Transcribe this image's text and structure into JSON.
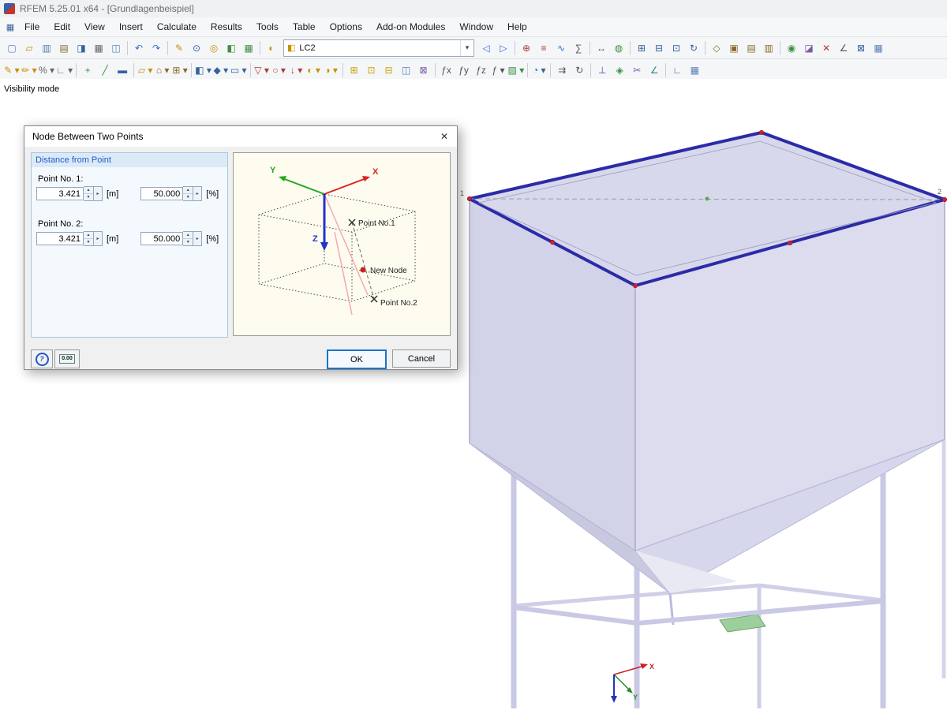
{
  "window": {
    "title": "RFEM 5.25.01 x64 - [Grundlagenbeispiel]"
  },
  "menu": {
    "items": [
      "File",
      "Edit",
      "View",
      "Insert",
      "Calculate",
      "Results",
      "Tools",
      "Table",
      "Options",
      "Add-on Modules",
      "Window",
      "Help"
    ]
  },
  "toolbar_main": {
    "left_icons": [
      {
        "name": "new-model-button",
        "glyph": "▢",
        "color": "#5a7fb5"
      },
      {
        "name": "open-model-button",
        "glyph": "▱",
        "color": "#c79100"
      },
      {
        "name": "project-manager-button",
        "glyph": "▥",
        "color": "#5a7fb5"
      },
      {
        "name": "data-navigator-button",
        "glyph": "▤",
        "color": "#8a6a2a"
      },
      {
        "name": "save-button",
        "glyph": "◨",
        "color": "#35629e"
      },
      {
        "name": "print-button",
        "glyph": "▦",
        "color": "#666666"
      },
      {
        "name": "copy-button",
        "glyph": "◫",
        "color": "#5a7fb5"
      },
      {
        "sep": true
      },
      {
        "name": "undo-button",
        "glyph": "↶",
        "color": "#2f6fd0"
      },
      {
        "name": "redo-button",
        "glyph": "↷",
        "color": "#2f6fd0"
      },
      {
        "sep": true
      },
      {
        "name": "new-load-case-button",
        "glyph": "✎",
        "color": "#c79100"
      },
      {
        "name": "zoom-select-button",
        "glyph": "⊙",
        "color": "#35629e"
      },
      {
        "name": "search-object-button",
        "glyph": "◎",
        "color": "#c79100"
      },
      {
        "name": "navigator-toggle-button",
        "glyph": "◧",
        "color": "#3f8f3f"
      },
      {
        "name": "tables-toggle-button",
        "glyph": "▦",
        "color": "#3f8f3f"
      },
      {
        "sep": true
      },
      {
        "name": "load-case-list-icon",
        "glyph": "◐",
        "color": "#c79100"
      }
    ],
    "combo": {
      "value": "LC2",
      "arrow": "▾",
      "icon": "◧"
    },
    "right_icons": [
      {
        "name": "previous-load-case-button",
        "glyph": "◁",
        "color": "#2f6fd0"
      },
      {
        "name": "next-load-case-button",
        "glyph": "▷",
        "color": "#2f6fd0"
      },
      {
        "sep": true
      },
      {
        "name": "show-loads-button",
        "glyph": "⊕",
        "color": "#b33838"
      },
      {
        "name": "show-load-values-button",
        "glyph": "≡",
        "color": "#b33838"
      },
      {
        "name": "show-results-button",
        "glyph": "∿",
        "color": "#2f6fd0"
      },
      {
        "name": "show-result-values-button",
        "glyph": "∑",
        "color": "#555555"
      },
      {
        "sep": true
      },
      {
        "name": "show-dimensions-button",
        "glyph": "↔",
        "color": "#555555"
      },
      {
        "name": "render-model-button",
        "glyph": "◍",
        "color": "#3f8f3f"
      },
      {
        "sep": true
      },
      {
        "name": "zoom-in-button",
        "glyph": "⊞",
        "color": "#35629e"
      },
      {
        "name": "zoom-out-button",
        "glyph": "⊟",
        "color": "#35629e"
      },
      {
        "name": "zoom-window-button",
        "glyph": "⊡",
        "color": "#35629e"
      },
      {
        "name": "rotate-view-button",
        "glyph": "↻",
        "color": "#35629e"
      },
      {
        "sep": true
      },
      {
        "name": "isometric-view-button",
        "glyph": "◇",
        "color": "#8a6a2a"
      },
      {
        "name": "view-in-x-button",
        "glyph": "▣",
        "color": "#8a6a2a"
      },
      {
        "name": "view-in-y-button",
        "glyph": "▤",
        "color": "#8a6a2a"
      },
      {
        "name": "view-in-z-button",
        "glyph": "▥",
        "color": "#8a6a2a"
      },
      {
        "sep": true
      },
      {
        "name": "visibility-mode-button",
        "glyph": "◉",
        "color": "#3f8f3f"
      },
      {
        "name": "clipping-plane-button",
        "glyph": "◪",
        "color": "#7a5aa0"
      },
      {
        "name": "mirror-view-button",
        "glyph": "✕",
        "color": "#b33838"
      },
      {
        "name": "measure-button",
        "glyph": "∠",
        "color": "#555555"
      },
      {
        "name": "full-view-button",
        "glyph": "⊠",
        "color": "#35629e"
      },
      {
        "name": "table-layout-button",
        "glyph": "▦",
        "color": "#5a7fb5"
      }
    ]
  },
  "toolbar_edit": {
    "icons": [
      {
        "name": "edit-dimensions-button",
        "glyph": "✎ ▾",
        "color": "#c79100"
      },
      {
        "name": "edit-comments-button",
        "glyph": "✏ ▾",
        "color": "#c79100"
      },
      {
        "name": "percent-snap-button",
        "glyph": "% ▾",
        "color": "#666666"
      },
      {
        "name": "ortho-snap-button",
        "glyph": "∟ ▾",
        "color": "#666666"
      },
      {
        "sep": true
      },
      {
        "name": "new-node-button",
        "glyph": "+",
        "color": "#3f8f3f"
      },
      {
        "name": "new-line-button",
        "glyph": "╱",
        "color": "#3f8f3f"
      },
      {
        "name": "new-member-button",
        "glyph": "▬",
        "color": "#35629e"
      },
      {
        "sep": true
      },
      {
        "name": "generated-objects-button",
        "glyph": "▱ ▾",
        "color": "#c79100"
      },
      {
        "name": "model-tools-button",
        "glyph": "⌂ ▾",
        "color": "#8a6a2a"
      },
      {
        "name": "block-library-button",
        "glyph": "⊞ ▾",
        "color": "#8a6a2a"
      },
      {
        "sep": true
      },
      {
        "name": "new-surface-button",
        "glyph": "◧ ▾",
        "color": "#35629e"
      },
      {
        "name": "new-solid-button",
        "glyph": "◆ ▾",
        "color": "#35629e"
      },
      {
        "name": "new-opening-button",
        "glyph": "▭ ▾",
        "color": "#35629e"
      },
      {
        "sep": true
      },
      {
        "name": "new-support-button",
        "glyph": "▽ ▾",
        "color": "#b33838"
      },
      {
        "name": "new-hinge-button",
        "glyph": "○ ▾",
        "color": "#b33838"
      },
      {
        "name": "new-load-button",
        "glyph": "↓ ▾",
        "color": "#b33838"
      },
      {
        "name": "load-cases-button",
        "glyph": "◐ ▾",
        "color": "#c79100"
      },
      {
        "name": "combinations-button",
        "glyph": "◑ ▾",
        "color": "#c79100"
      },
      {
        "sep": true
      },
      {
        "name": "select-window-button",
        "glyph": "⊞",
        "color": "#caa000"
      },
      {
        "name": "select-special-button",
        "glyph": "⊡",
        "color": "#caa000"
      },
      {
        "name": "deselect-button",
        "glyph": "⊟",
        "color": "#caa000"
      },
      {
        "name": "select-layer-button",
        "glyph": "◫",
        "color": "#5a7fb5"
      },
      {
        "name": "numbering-button",
        "glyph": "⊠",
        "color": "#7a5aa0"
      },
      {
        "sep": true
      },
      {
        "name": "member-rotation-x-button",
        "glyph": "ƒx",
        "color": "#555555"
      },
      {
        "name": "member-rotation-y-button",
        "glyph": "ƒy",
        "color": "#555555"
      },
      {
        "name": "member-rotation-z-button",
        "glyph": "ƒz",
        "color": "#555555"
      },
      {
        "name": "member-division-button",
        "glyph": "ƒ ▾",
        "color": "#555555"
      },
      {
        "name": "background-layers-button",
        "glyph": "▨ ▾",
        "color": "#3f8f3f"
      },
      {
        "sep": true
      },
      {
        "name": "calculation-button",
        "glyph": "◔ ▾",
        "color": "#35629e"
      },
      {
        "sep": true
      },
      {
        "name": "move-copy-button",
        "glyph": "⇉",
        "color": "#555555"
      },
      {
        "name": "rotate-copy-button",
        "glyph": "↻",
        "color": "#555555"
      },
      {
        "sep": true
      },
      {
        "name": "align-button",
        "glyph": "⊥",
        "color": "#35629e"
      },
      {
        "name": "project-to-plane-button",
        "glyph": "◈",
        "color": "#3f8f3f"
      },
      {
        "name": "trim-members-button",
        "glyph": "✂",
        "color": "#7a5aa0"
      },
      {
        "name": "connect-lines-button",
        "glyph": "∠",
        "color": "#2a8a8a"
      },
      {
        "sep": true
      },
      {
        "name": "work-plane-button",
        "glyph": "∟",
        "color": "#35629e"
      },
      {
        "name": "grid-settings-button",
        "glyph": "▦",
        "color": "#5a7fb5"
      }
    ]
  },
  "viewport": {
    "mode_label": "Visibility mode",
    "node_label_left": "1",
    "node_label_right": "2",
    "axis_x": "X",
    "axis_y": "Y"
  },
  "dialog": {
    "title": "Node Between Two Points",
    "close_glyph": "✕",
    "group_title": "Distance from Point",
    "point1": {
      "label": "Point No. 1:",
      "value": "3.421",
      "unit": "[m]",
      "percent": "50.000",
      "percent_unit": "[%]"
    },
    "point2": {
      "label": "Point No. 2:",
      "value": "3.421",
      "unit": "[m]",
      "percent": "50.000",
      "percent_unit": "[%]"
    },
    "controls": {
      "spin_up": "▲",
      "spin_down": "▼",
      "expand": "▸"
    },
    "illustration": {
      "x": "X",
      "y": "Y",
      "z": "Z",
      "point1": "Point No.1",
      "new_node": "New Node",
      "point2": "Point No.2"
    },
    "help_glyph": "?",
    "calc_label": "0.00",
    "ok": "OK",
    "cancel": "Cancel"
  },
  "colors": {
    "model_face_top": "#d8d8ec",
    "model_face_left": "#d2d2e8",
    "model_face_right": "#dcdcee",
    "hopper_left": "#c8c8e1",
    "hopper_right": "#d6d6ec",
    "frame": "#c9c9e5",
    "rim_highlight": "#2b2ba8",
    "node_red": "#cc2233",
    "pad_green": "#9ccf9c",
    "axis_x": "#cc2222",
    "axis_y": "#2a8a2a",
    "axis_z": "#2233bb",
    "group_header_blue": "#1a5dc8",
    "ok_focus_blue": "#1b74c9"
  }
}
